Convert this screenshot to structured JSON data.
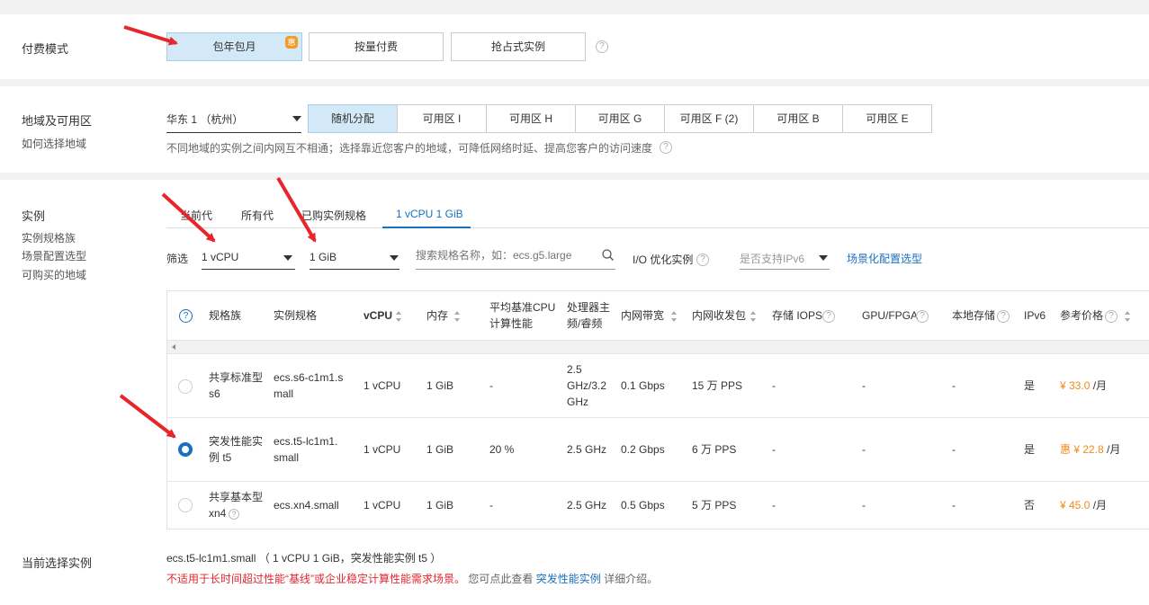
{
  "billing": {
    "label": "付费模式",
    "options": [
      "包年包月",
      "按量付费",
      "抢占式实例"
    ],
    "badge": "惠"
  },
  "region": {
    "label": "地域及可用区",
    "sub_link": "如何选择地域",
    "region_value": "华东 1 （杭州）",
    "zones": [
      "随机分配",
      "可用区 I",
      "可用区 H",
      "可用区 G",
      "可用区 F (2)",
      "可用区 B",
      "可用区 E"
    ],
    "hint": "不同地域的实例之间内网互不相通；选择靠近您客户的地域，可降低网络时延、提高您客户的访问速度"
  },
  "instance": {
    "label": "实例",
    "links": [
      "实例规格族",
      "场景配置选型",
      "可购买的地域"
    ],
    "tabs": [
      "当前代",
      "所有代",
      "已购实例规格",
      "1 vCPU 1 GiB"
    ],
    "filter_label": "筛选",
    "vcpu_value": "1 vCPU",
    "mem_value": "1 GiB",
    "search_placeholder": "搜索规格名称，如：ecs.g5.large",
    "io_label": "I/O 优化实例",
    "ipv6_placeholder": "是否支持IPv6",
    "scene_link": "场景化配置选型"
  },
  "table": {
    "headers": {
      "family": "规格族",
      "spec": "实例规格",
      "vcpu": "vCPU",
      "mem": "内存",
      "perf": "平均基准CPU计算性能",
      "cpu_freq": "处理器主频/睿频",
      "bw": "内网带宽",
      "pps": "内网收发包",
      "iops": "存储 IOPS",
      "gpu": "GPU/FPGA",
      "local": "本地存储",
      "ipv6": "IPv6",
      "price": "参考价格"
    },
    "rows": [
      {
        "family": "共享标准型 s6",
        "spec": "ecs.s6-c1m1.small",
        "vcpu": "1 vCPU",
        "mem": "1 GiB",
        "perf": "-",
        "freq": "2.5 GHz/3.2 GHz",
        "bw": "0.1 Gbps",
        "pps": "15 万 PPS",
        "iops": "-",
        "gpu": "-",
        "local": "-",
        "ipv6": "是",
        "price": "¥ 33.0",
        "unit": "/月",
        "selected": false
      },
      {
        "family": "突发性能实例 t5",
        "spec": "ecs.t5-lc1m1.small",
        "vcpu": "1 vCPU",
        "mem": "1 GiB",
        "perf": "20 %",
        "freq": "2.5 GHz",
        "bw": "0.2 Gbps",
        "pps": "6 万 PPS",
        "iops": "-",
        "gpu": "-",
        "local": "-",
        "ipv6": "是",
        "price": "惠 ¥ 22.8",
        "unit": "/月",
        "selected": true
      },
      {
        "family": "共享基本型 xn4",
        "spec": "ecs.xn4.small",
        "vcpu": "1 vCPU",
        "mem": "1 GiB",
        "perf": "-",
        "freq": "2.5 GHz",
        "bw": "0.5 Gbps",
        "pps": "5 万 PPS",
        "iops": "-",
        "gpu": "-",
        "local": "-",
        "ipv6": "否",
        "price": "¥ 45.0",
        "unit": "/月",
        "selected": false
      }
    ]
  },
  "current": {
    "label": "当前选择实例",
    "value": "ecs.t5-lc1m1.small （ 1 vCPU 1 GiB，突发性能实例 t5 ）",
    "warning": "不适用于长时间超过性能“基线”或企业稳定计算性能需求场景。",
    "see_text": "您可点此查看",
    "link": "突发性能实例",
    "tail": "详细介绍。"
  },
  "colors": {
    "accent": "#1a6fc0",
    "price": "#f08b1a",
    "warning": "#e0262f",
    "arrow": "#e8252b"
  }
}
